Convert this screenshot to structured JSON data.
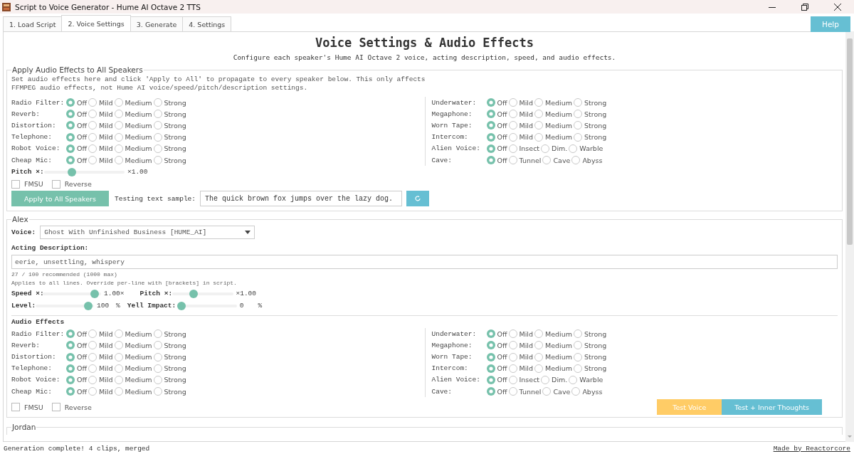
{
  "window": {
    "title": "Script to Voice Generator - Hume AI Octave 2 TTS"
  },
  "tabs": [
    {
      "label": "1. Load Script",
      "selected": false
    },
    {
      "label": "2. Voice Settings",
      "selected": true
    },
    {
      "label": "3. Generate",
      "selected": false
    },
    {
      "label": "4. Settings",
      "selected": false
    }
  ],
  "help_button": "Help",
  "header": {
    "title": "Voice Settings & Audio Effects",
    "subtitle": "Configure each speaker's Hume AI Octave 2 voice, acting description, speed, and audio effects."
  },
  "global_effects": {
    "legend": "Apply Audio Effects to All Speakers",
    "note": "Set audio effects here and click 'Apply to All' to propagate to every speaker below. This only affects FFMPEG audio effects, not Hume AI voice/speed/pitch/description settings.",
    "left": [
      {
        "label": "Radio Filter:",
        "options": [
          {
            "label": "Off",
            "selected": true
          },
          {
            "label": "Mild",
            "selected": false
          },
          {
            "label": "Medium",
            "selected": false
          },
          {
            "label": "Strong",
            "selected": false
          }
        ]
      },
      {
        "label": "Reverb:",
        "options": [
          {
            "label": "Off",
            "selected": true
          },
          {
            "label": "Mild",
            "selected": false
          },
          {
            "label": "Medium",
            "selected": false
          },
          {
            "label": "Strong",
            "selected": false
          }
        ]
      },
      {
        "label": "Distortion:",
        "options": [
          {
            "label": "Off",
            "selected": true
          },
          {
            "label": "Mild",
            "selected": false
          },
          {
            "label": "Medium",
            "selected": false
          },
          {
            "label": "Strong",
            "selected": false
          }
        ]
      },
      {
        "label": "Telephone:",
        "options": [
          {
            "label": "Off",
            "selected": true
          },
          {
            "label": "Mild",
            "selected": false
          },
          {
            "label": "Medium",
            "selected": false
          },
          {
            "label": "Strong",
            "selected": false
          }
        ]
      },
      {
        "label": "Robot Voice:",
        "options": [
          {
            "label": "Off",
            "selected": true
          },
          {
            "label": "Mild",
            "selected": false
          },
          {
            "label": "Medium",
            "selected": false
          },
          {
            "label": "Strong",
            "selected": false
          }
        ]
      },
      {
        "label": "Cheap Mic:",
        "options": [
          {
            "label": "Off",
            "selected": true
          },
          {
            "label": "Mild",
            "selected": false
          },
          {
            "label": "Medium",
            "selected": false
          },
          {
            "label": "Strong",
            "selected": false
          }
        ]
      }
    ],
    "right": [
      {
        "label": "Underwater:",
        "options": [
          {
            "label": "Off",
            "selected": true
          },
          {
            "label": "Mild",
            "selected": false
          },
          {
            "label": "Medium",
            "selected": false
          },
          {
            "label": "Strong",
            "selected": false
          }
        ]
      },
      {
        "label": "Megaphone:",
        "options": [
          {
            "label": "Off",
            "selected": true
          },
          {
            "label": "Mild",
            "selected": false
          },
          {
            "label": "Medium",
            "selected": false
          },
          {
            "label": "Strong",
            "selected": false
          }
        ]
      },
      {
        "label": "Worn Tape:",
        "options": [
          {
            "label": "Off",
            "selected": true
          },
          {
            "label": "Mild",
            "selected": false
          },
          {
            "label": "Medium",
            "selected": false
          },
          {
            "label": "Strong",
            "selected": false
          }
        ]
      },
      {
        "label": "Intercom:",
        "options": [
          {
            "label": "Off",
            "selected": true
          },
          {
            "label": "Mild",
            "selected": false
          },
          {
            "label": "Medium",
            "selected": false
          },
          {
            "label": "Strong",
            "selected": false
          }
        ]
      },
      {
        "label": "Alien Voice:",
        "options": [
          {
            "label": "Off",
            "selected": true
          },
          {
            "label": "Insect",
            "selected": false
          },
          {
            "label": "Dim.",
            "selected": false
          },
          {
            "label": "Warble",
            "selected": false
          }
        ]
      },
      {
        "label": "Cave:",
        "options": [
          {
            "label": "Off",
            "selected": true
          },
          {
            "label": "Tunnel",
            "selected": false
          },
          {
            "label": "Cave",
            "selected": false
          },
          {
            "label": "Abyss",
            "selected": false
          }
        ]
      }
    ],
    "pitch": {
      "label": "Pitch ×:",
      "level": 0.33,
      "reading": "×1.00"
    },
    "toggles": [
      {
        "label": "FMSU",
        "checked": false
      },
      {
        "label": "Reverse",
        "checked": false
      }
    ],
    "apply_button": "Apply to All Speakers",
    "sample_label": "Testing text sample:",
    "sample_value": "The quick brown fox jumps over the lazy dog."
  },
  "speakers": [
    {
      "name": "Alex",
      "voice_label": "Voice:",
      "voice_value": "Ghost With Unfinished Business  [HUME_AI]",
      "description_label": "Acting Description:",
      "description_value": "eerie, unsettling, whispery",
      "counter": "27 / 100 recommended  (1000 max)",
      "hint": "Applies to all lines. Override per-line with [brackets] in script.",
      "sliders": [
        {
          "label": "Speed ×:",
          "level": 0.96,
          "reading": "1.00×"
        },
        {
          "label": "Pitch ×:",
          "level": 0.33,
          "reading": "×1.00"
        },
        {
          "label": "Level:",
          "level": 0.97,
          "reading": "100",
          "unit": "%"
        },
        {
          "label": "Yell Impact:",
          "level": 0,
          "reading": "0",
          "unit": "%"
        }
      ],
      "effects_heading": "Audio Effects",
      "left": [
        {
          "label": "Radio Filter:",
          "options": [
            {
              "label": "Off",
              "selected": true
            },
            {
              "label": "Mild",
              "selected": false
            },
            {
              "label": "Medium",
              "selected": false
            },
            {
              "label": "Strong",
              "selected": false
            }
          ]
        },
        {
          "label": "Reverb:",
          "options": [
            {
              "label": "Off",
              "selected": true
            },
            {
              "label": "Mild",
              "selected": false
            },
            {
              "label": "Medium",
              "selected": false
            },
            {
              "label": "Strong",
              "selected": false
            }
          ]
        },
        {
          "label": "Distortion:",
          "options": [
            {
              "label": "Off",
              "selected": true
            },
            {
              "label": "Mild",
              "selected": false
            },
            {
              "label": "Medium",
              "selected": false
            },
            {
              "label": "Strong",
              "selected": false
            }
          ]
        },
        {
          "label": "Telephone:",
          "options": [
            {
              "label": "Off",
              "selected": true
            },
            {
              "label": "Mild",
              "selected": false
            },
            {
              "label": "Medium",
              "selected": false
            },
            {
              "label": "Strong",
              "selected": false
            }
          ]
        },
        {
          "label": "Robot Voice:",
          "options": [
            {
              "label": "Off",
              "selected": true
            },
            {
              "label": "Mild",
              "selected": false
            },
            {
              "label": "Medium",
              "selected": false
            },
            {
              "label": "Strong",
              "selected": false
            }
          ]
        },
        {
          "label": "Cheap Mic:",
          "options": [
            {
              "label": "Off",
              "selected": true
            },
            {
              "label": "Mild",
              "selected": false
            },
            {
              "label": "Medium",
              "selected": false
            },
            {
              "label": "Strong",
              "selected": false
            }
          ]
        }
      ],
      "right": [
        {
          "label": "Underwater:",
          "options": [
            {
              "label": "Off",
              "selected": true
            },
            {
              "label": "Mild",
              "selected": false
            },
            {
              "label": "Medium",
              "selected": false
            },
            {
              "label": "Strong",
              "selected": false
            }
          ]
        },
        {
          "label": "Megaphone:",
          "options": [
            {
              "label": "Off",
              "selected": true
            },
            {
              "label": "Mild",
              "selected": false
            },
            {
              "label": "Medium",
              "selected": false
            },
            {
              "label": "Strong",
              "selected": false
            }
          ]
        },
        {
          "label": "Worn Tape:",
          "options": [
            {
              "label": "Off",
              "selected": true
            },
            {
              "label": "Mild",
              "selected": false
            },
            {
              "label": "Medium",
              "selected": false
            },
            {
              "label": "Strong",
              "selected": false
            }
          ]
        },
        {
          "label": "Intercom:",
          "options": [
            {
              "label": "Off",
              "selected": true
            },
            {
              "label": "Mild",
              "selected": false
            },
            {
              "label": "Medium",
              "selected": false
            },
            {
              "label": "Strong",
              "selected": false
            }
          ]
        },
        {
          "label": "Alien Voice:",
          "options": [
            {
              "label": "Off",
              "selected": true
            },
            {
              "label": "Insect",
              "selected": false
            },
            {
              "label": "Dim.",
              "selected": false
            },
            {
              "label": "Warble",
              "selected": false
            }
          ]
        },
        {
          "label": "Cave:",
          "options": [
            {
              "label": "Off",
              "selected": true
            },
            {
              "label": "Tunnel",
              "selected": false
            },
            {
              "label": "Cave",
              "selected": false
            },
            {
              "label": "Abyss",
              "selected": false
            }
          ]
        }
      ],
      "toggles": [
        {
          "label": "FMSU",
          "checked": false
        },
        {
          "label": "Reverse",
          "checked": false
        }
      ],
      "buttons": [
        {
          "label": "Test Voice",
          "kind": "warning"
        },
        {
          "label": "Test + Inner Thoughts",
          "kind": "info"
        }
      ]
    },
    {
      "name": "Jordan"
    }
  ],
  "status_bar": {
    "message": "Generation complete! 4 clips, merged",
    "credit": "Made by Reactorcore"
  }
}
